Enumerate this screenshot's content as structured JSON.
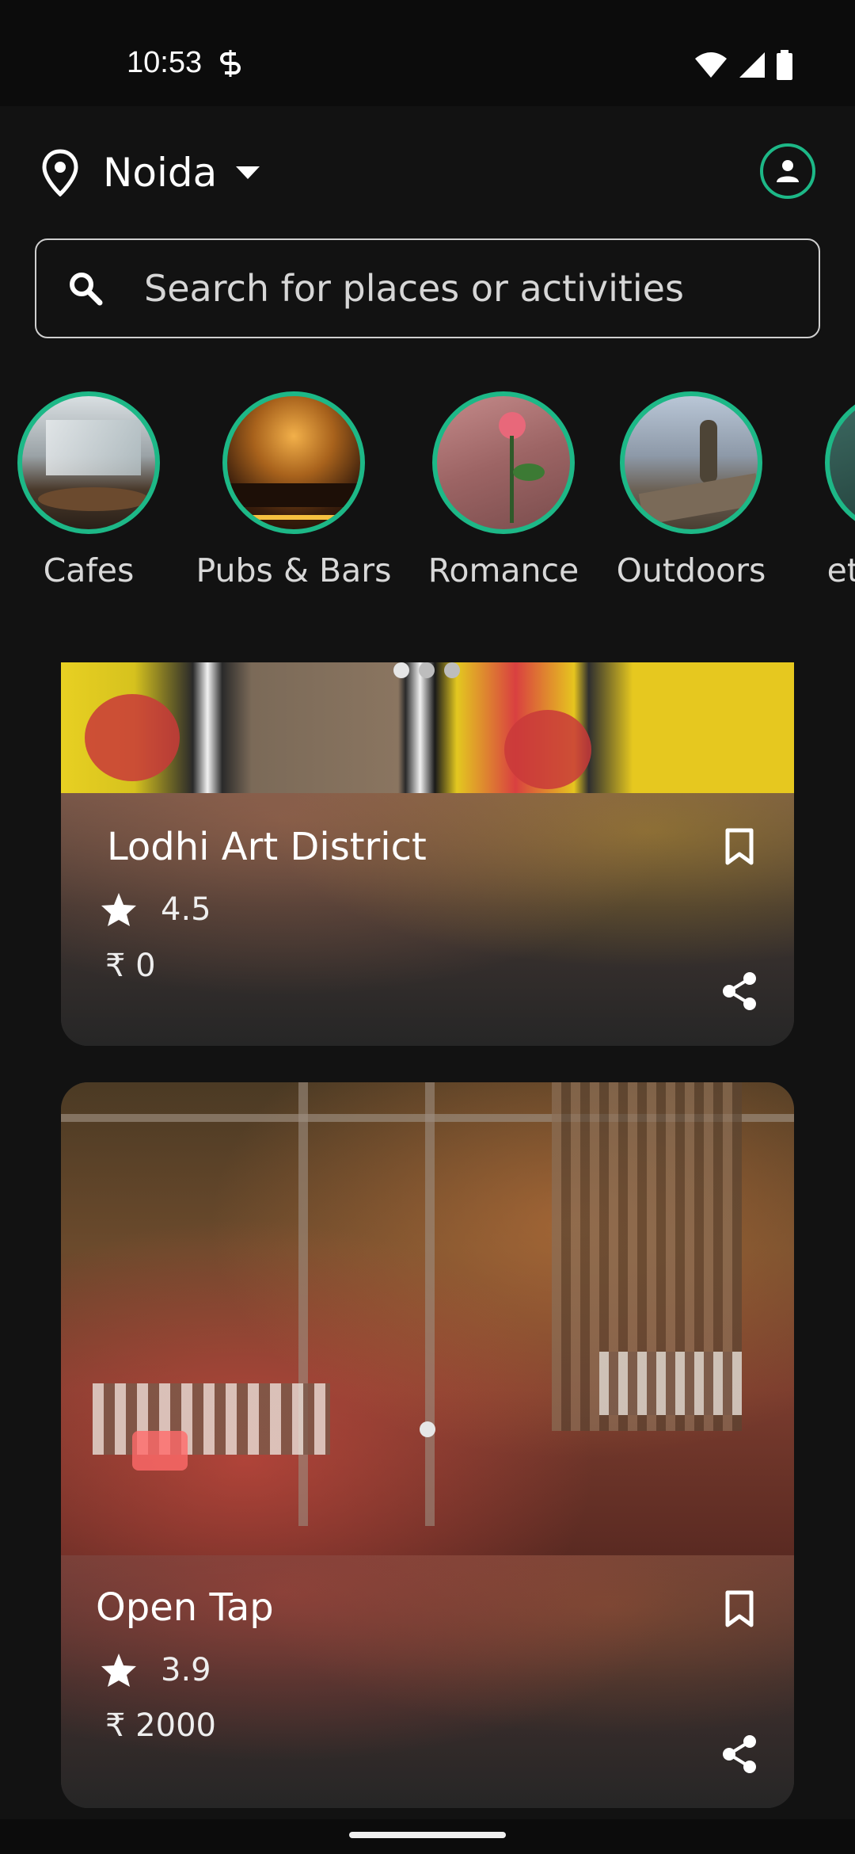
{
  "status_bar": {
    "time": "10:53"
  },
  "header": {
    "location": "Noida"
  },
  "search": {
    "placeholder": "Search for places or activities"
  },
  "categories": [
    {
      "label": "Cafes"
    },
    {
      "label": "Pubs & Bars"
    },
    {
      "label": "Romance"
    },
    {
      "label": "Outdoors"
    },
    {
      "label": "Net"
    }
  ],
  "cards": [
    {
      "title": "Lodhi Art District",
      "rating": "4.5",
      "price": "₹ 0"
    },
    {
      "title": "Open Tap",
      "rating": "3.9",
      "price": "₹ 2000"
    }
  ],
  "colors": {
    "accent": "#1db887",
    "background": "#121212"
  }
}
